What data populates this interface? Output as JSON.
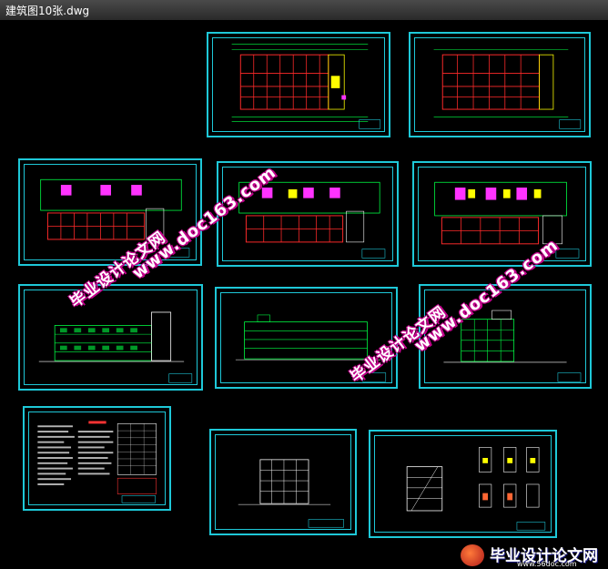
{
  "window": {
    "title": "建筑图10张.dwg"
  },
  "watermarks": {
    "site_url": "www.doc163.com",
    "site_name": "毕业设计论文网"
  },
  "footer": {
    "brand": "毕业设计论文网",
    "url": "www.56doc.com"
  },
  "colors": {
    "frame": "#1ec8d8",
    "grid": "#ff2a2a",
    "wall": "#00ff44",
    "highlight": "#ffff00",
    "accent": "#ff33ff"
  },
  "sheets": [
    {
      "name": "floor-plan-1",
      "kind": "plan-grid"
    },
    {
      "name": "floor-plan-2",
      "kind": "plan-grid"
    },
    {
      "name": "floor-plan-3",
      "kind": "plan-rooms"
    },
    {
      "name": "floor-plan-4",
      "kind": "plan-rooms"
    },
    {
      "name": "floor-plan-5",
      "kind": "plan-rooms"
    },
    {
      "name": "elevation-1",
      "kind": "elevation"
    },
    {
      "name": "elevation-2",
      "kind": "elevation"
    },
    {
      "name": "elevation-3",
      "kind": "elevation"
    },
    {
      "name": "design-notes",
      "kind": "notes"
    },
    {
      "name": "elevation-4",
      "kind": "elevation"
    },
    {
      "name": "section-details",
      "kind": "details"
    }
  ]
}
